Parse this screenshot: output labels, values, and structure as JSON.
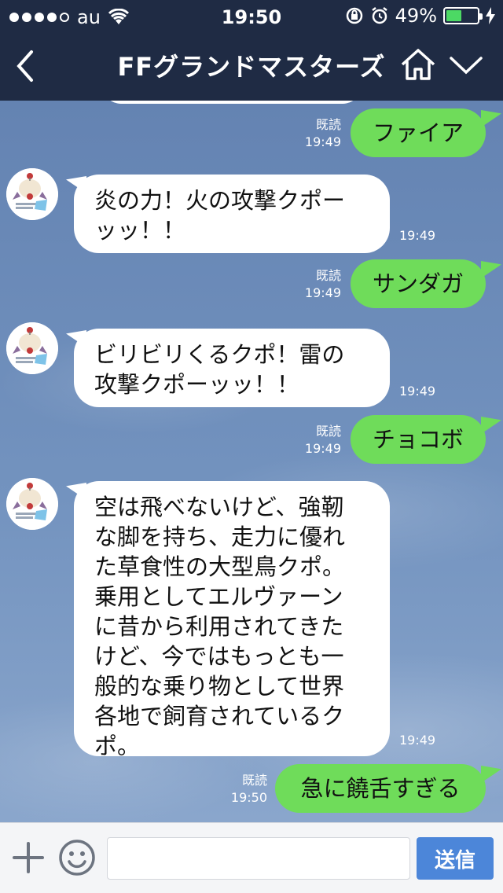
{
  "status_bar": {
    "carrier": "au",
    "time": "19:50",
    "battery": "49%",
    "battery_level": 0.49
  },
  "nav": {
    "title": "FFグランドマスターズ"
  },
  "messages": [
    {
      "side": "sent",
      "text": "ファイア",
      "read": "既読",
      "time": "19:49"
    },
    {
      "side": "received",
      "lines": [
        "炎の力！火の攻撃クポー",
        "ッッ！！"
      ],
      "time": "19:49"
    },
    {
      "side": "sent",
      "text": "サンダガ",
      "read": "既読",
      "time": "19:49"
    },
    {
      "side": "received",
      "lines": [
        "ビリビリくるクポ！雷の",
        "攻撃クポーッッ！！"
      ],
      "time": "19:49"
    },
    {
      "side": "sent",
      "text": "チョコボ",
      "read": "既読",
      "time": "19:49"
    },
    {
      "side": "received",
      "lines": [
        "空は飛べないけど、強靭",
        "な脚を持ち、走力に優れ",
        "た草食性の大型鳥クポ。",
        "乗用としてエルヴァーン",
        "に昔から利用されてきた",
        "けど、今ではもっとも一",
        "般的な乗り物として世界",
        "各地で飼育されているク",
        "ポ。"
      ],
      "time": "19:49"
    },
    {
      "side": "sent",
      "text": "急に饒舌すぎる",
      "read": "既読",
      "time": "19:50"
    }
  ],
  "input": {
    "placeholder": "",
    "send_label": "送信"
  },
  "colors": {
    "header_bg": "#1f2b44",
    "sent_bubble": "#6fdc5a",
    "send_button": "#4c86d9"
  }
}
